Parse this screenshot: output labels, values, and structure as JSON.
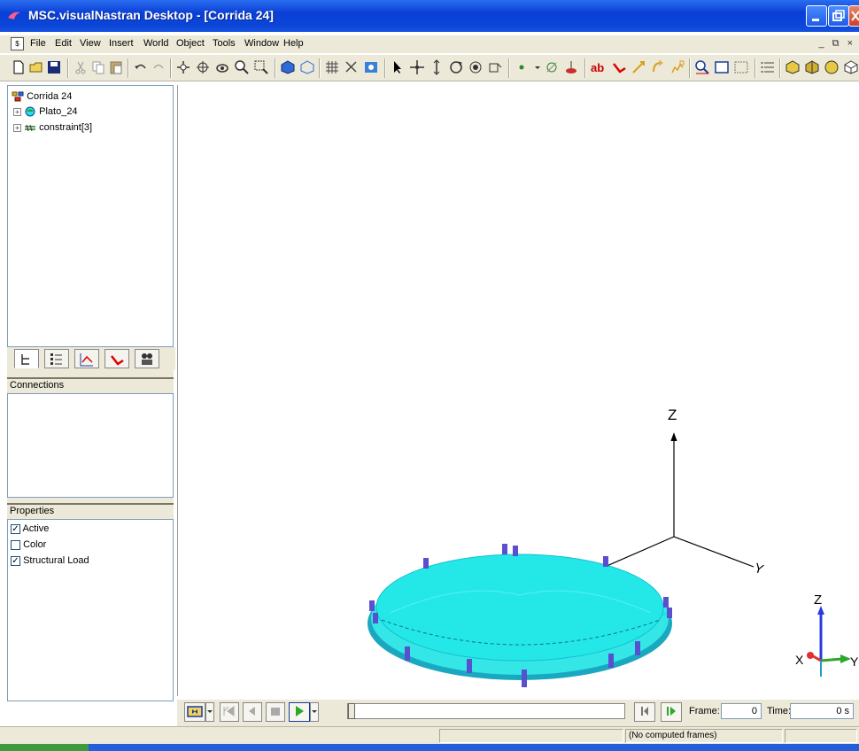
{
  "window": {
    "title": "MSC.visualNastran Desktop - [Corrida 24]"
  },
  "menu": [
    "File",
    "Edit",
    "View",
    "Insert",
    "World",
    "Object",
    "Tools",
    "Window",
    "Help"
  ],
  "tree": {
    "root": "Corrida 24",
    "items": [
      "Plato_24",
      "constraint[3]"
    ]
  },
  "connections": {
    "title": "Connections"
  },
  "properties": {
    "title": "Properties",
    "items": [
      {
        "label": "Active",
        "checked": true
      },
      {
        "label": "Color",
        "checked": false
      },
      {
        "label": "Structural Load",
        "checked": true
      }
    ]
  },
  "axes": {
    "z": "Z",
    "y": "Y",
    "x": "X"
  },
  "playback": {
    "frame_label": "Frame:",
    "frame_value": "0",
    "time_label": "Time:",
    "time_value": "0 s"
  },
  "status": {
    "message": "(No computed frames)"
  },
  "colors": {
    "disk": "#1ee3e3",
    "titlebar": "#0a3fd6",
    "constraint": "#5a4fcf"
  }
}
